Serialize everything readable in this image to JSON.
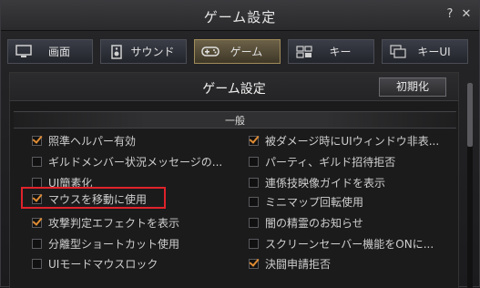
{
  "window": {
    "title": "ゲーム設定",
    "help_label": "?",
    "close_label": "✕"
  },
  "tabs": [
    {
      "label": "画面",
      "icon": "monitor-icon",
      "active": false
    },
    {
      "label": "サウンド",
      "icon": "speaker-icon",
      "active": false
    },
    {
      "label": "ゲーム",
      "icon": "gamepad-icon",
      "active": true
    },
    {
      "label": "キー",
      "icon": "keyboard-icon",
      "active": false
    },
    {
      "label": "キーUI",
      "icon": "windows-icon",
      "active": false
    }
  ],
  "panel": {
    "title": "ゲーム設定",
    "reset_label": "初期化"
  },
  "section": {
    "label": "一般"
  },
  "options_left": [
    {
      "label": "照準ヘルパー有効",
      "checked": true
    },
    {
      "label": "ギルドメンバー状況メッセージの...",
      "checked": false
    },
    {
      "label": "UI簡素化",
      "checked": false
    },
    {
      "label": "マウスを移動に使用",
      "checked": true
    },
    {
      "label": "攻撃判定エフェクトを表示",
      "checked": true
    },
    {
      "label": "分離型ショートカット使用",
      "checked": false
    },
    {
      "label": "UIモードマウスロック",
      "checked": false
    }
  ],
  "options_right": [
    {
      "label": "被ダメージ時にUIウィンドウ非表...",
      "checked": true
    },
    {
      "label": "パーティ、ギルド招待拒否",
      "checked": false
    },
    {
      "label": "連係技映像ガイドを表示",
      "checked": false
    },
    {
      "label": "ミニマップ回転使用",
      "checked": false
    },
    {
      "label": "闇の精霊のお知らせ",
      "checked": false
    },
    {
      "label": "スクリーンセーバー機能をONに...",
      "checked": false
    },
    {
      "label": "決闘申請拒否",
      "checked": true
    }
  ],
  "colors": {
    "accent_check": "#e08c33",
    "highlight_box": "#e0232b"
  }
}
